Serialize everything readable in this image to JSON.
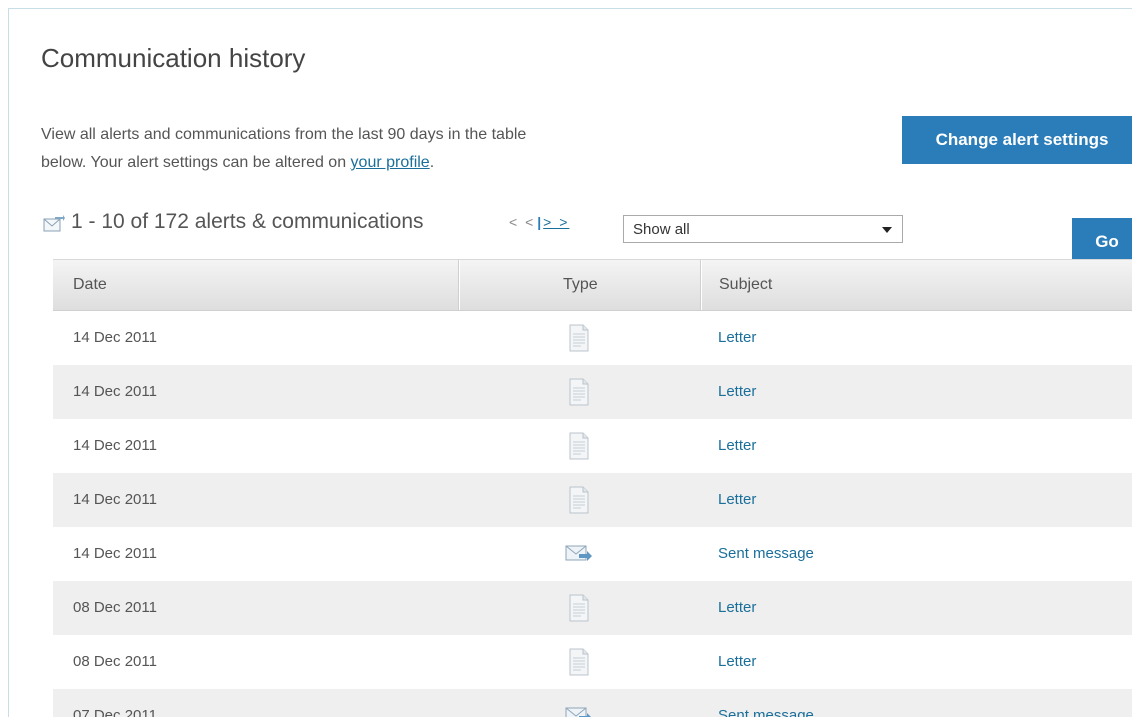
{
  "page": {
    "title": "Communication history",
    "intro_line1": "View all alerts and communications from the last 90 days in the table",
    "intro_line2_prefix": "below. Your alert settings can be altered on ",
    "intro_link": "your profile",
    "intro_line2_suffix": "."
  },
  "actions": {
    "change_alert_settings": "Change alert settings",
    "go": "Go"
  },
  "results": {
    "count_text": "1 - 10 of 172 alerts & communications",
    "prev_label": "< <",
    "separator": "|",
    "next_label": "> >"
  },
  "filter": {
    "selected": "Show all"
  },
  "table": {
    "headers": {
      "date": "Date",
      "type": "Type",
      "subject": "Subject"
    },
    "rows": [
      {
        "date": "14 Dec 2011",
        "type_icon": "document-icon",
        "subject": "Letter"
      },
      {
        "date": "14 Dec 2011",
        "type_icon": "document-icon",
        "subject": "Letter"
      },
      {
        "date": "14 Dec 2011",
        "type_icon": "document-icon",
        "subject": "Letter"
      },
      {
        "date": "14 Dec 2011",
        "type_icon": "document-icon",
        "subject": "Letter"
      },
      {
        "date": "14 Dec 2011",
        "type_icon": "sent-mail-icon",
        "subject": "Sent message"
      },
      {
        "date": "08 Dec 2011",
        "type_icon": "document-icon",
        "subject": "Letter"
      },
      {
        "date": "08 Dec 2011",
        "type_icon": "document-icon",
        "subject": "Letter"
      },
      {
        "date": "07 Dec 2011",
        "type_icon": "sent-mail-icon",
        "subject": "Sent message"
      }
    ]
  },
  "colors": {
    "accent": "#2a7db8",
    "link": "#1a6f9a",
    "row_alt": "#efefef"
  }
}
